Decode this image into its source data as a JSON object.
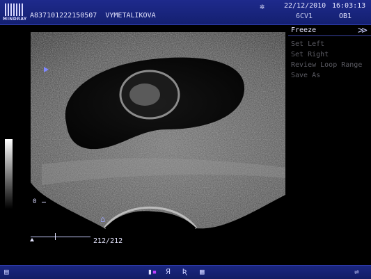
{
  "header": {
    "logo_text": "MINDRAY",
    "patient_info": "A837101222150507  VYMETALIKOVA",
    "date": "22/12/2010",
    "time": "16:03:13",
    "probe": "6CV1",
    "exam": "OB1"
  },
  "menu": {
    "items": [
      {
        "label": "Freeze",
        "active": true
      },
      {
        "label": "Set Left",
        "active": false
      },
      {
        "label": "Set Right",
        "active": false
      },
      {
        "label": "Review Loop Range",
        "active": false
      },
      {
        "label": "Save As",
        "active": false
      }
    ],
    "expand_icon": "double-chevron-right-icon"
  },
  "image": {
    "depth_zero_label": "0",
    "frame_counter": "212/212",
    "cine_position": 0.41
  },
  "status_icons": [
    "display-icon",
    "color-map-icon",
    "r-mirror-icon",
    "r-icon",
    "document-icon",
    "usb-icon"
  ],
  "colors": {
    "bar_bg": "#1e2a8c",
    "menu_active": "#e6e6ff",
    "menu_inactive": "#5c5c64"
  }
}
